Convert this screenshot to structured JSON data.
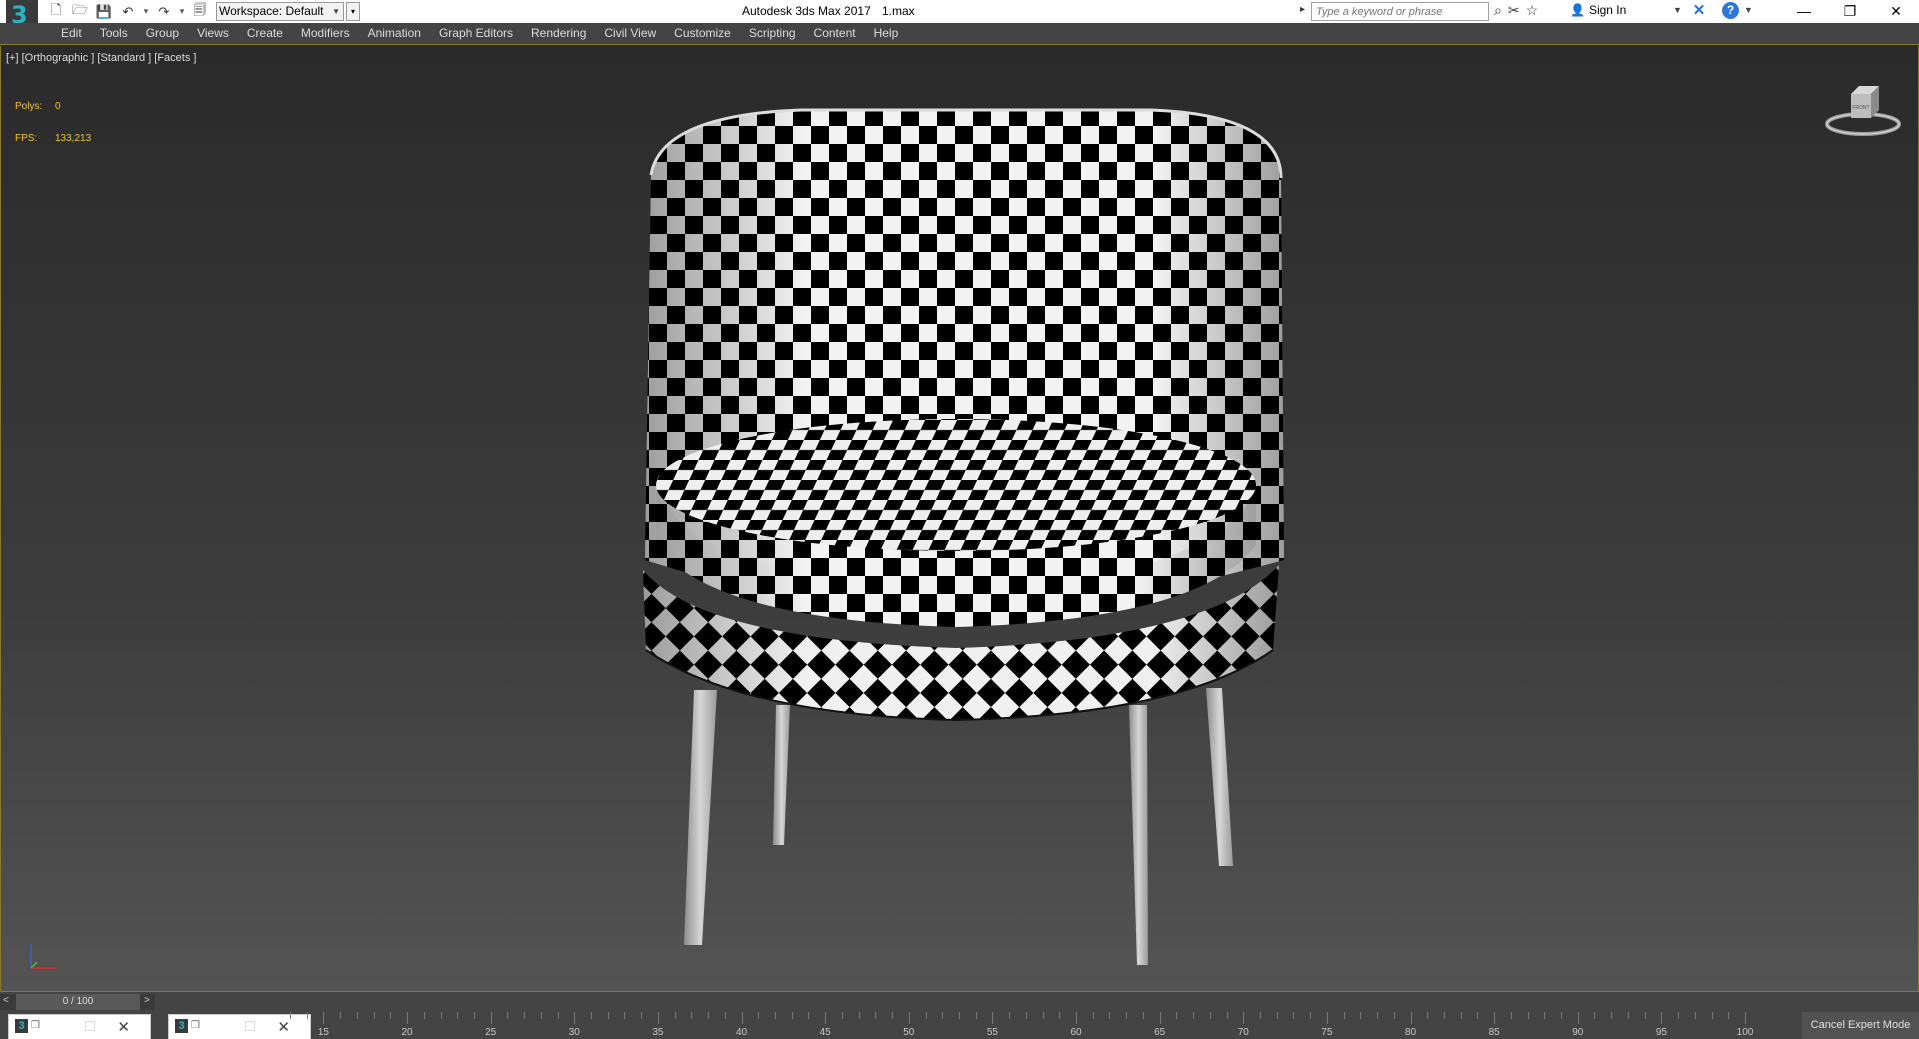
{
  "app": {
    "logo": "3",
    "title": "Autodesk 3ds Max 2017",
    "file": "1.max",
    "workspace": "Workspace: Default",
    "search_placeholder": "Type a keyword or phrase",
    "sign_in": "Sign In",
    "help": "?",
    "window_controls": {
      "minimize": "—",
      "restore": "❐",
      "close": "✕"
    }
  },
  "quick_access_icons": [
    "new-file-icon",
    "open-file-icon",
    "save-icon",
    "undo-icon",
    "redo-icon",
    "project-folder-icon"
  ],
  "menu": [
    "Edit",
    "Tools",
    "Group",
    "Views",
    "Create",
    "Modifiers",
    "Animation",
    "Graph Editors",
    "Rendering",
    "Civil View",
    "Customize",
    "Scripting",
    "Content",
    "Help"
  ],
  "viewport": {
    "label": "[+] [Orthographic ] [Standard ] [Facets ]",
    "stats": [
      {
        "name": "Polys:",
        "value": "0"
      },
      {
        "name": "FPS:",
        "value": "133,213"
      }
    ],
    "viewcube_label": "FRONT",
    "colors": {
      "stats": "#f0c42c",
      "checker_dark": "#000000",
      "checker_light": "#f2f2f2",
      "legs": "#b8b8b8"
    }
  },
  "timeline": {
    "frame": "0 / 100",
    "ticks": [
      "15",
      "20",
      "25",
      "30",
      "35",
      "40",
      "45",
      "50",
      "55",
      "60",
      "65",
      "70",
      "75",
      "80",
      "85",
      "90",
      "95",
      "100"
    ],
    "cancel_expert": "Cancel Expert Mode"
  }
}
